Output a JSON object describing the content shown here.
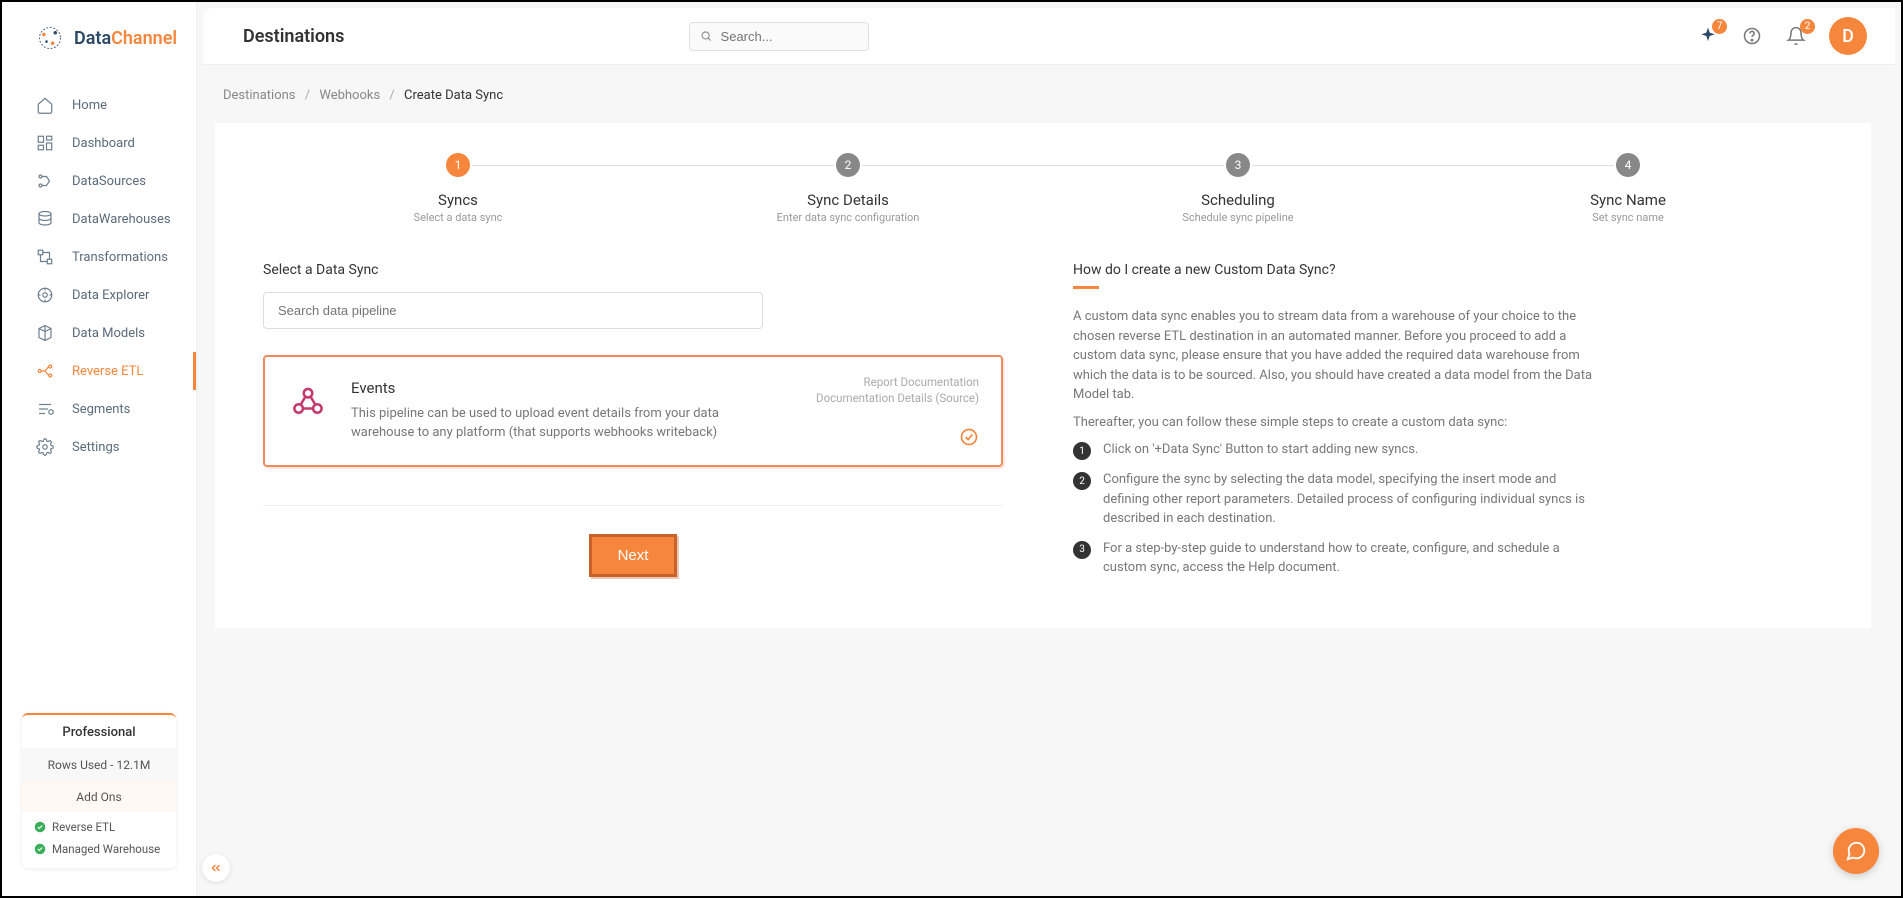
{
  "brand": {
    "part1": "Data",
    "part2": "Channel"
  },
  "sidebar": {
    "items": [
      {
        "label": "Home"
      },
      {
        "label": "Dashboard"
      },
      {
        "label": "DataSources"
      },
      {
        "label": "DataWarehouses"
      },
      {
        "label": "Transformations"
      },
      {
        "label": "Data Explorer"
      },
      {
        "label": "Data Models"
      },
      {
        "label": "Reverse ETL"
      },
      {
        "label": "Segments"
      },
      {
        "label": "Settings"
      }
    ],
    "plan": {
      "title": "Professional",
      "rows": "Rows Used - 12.1M",
      "addons": "Add Ons",
      "features": [
        "Reverse ETL",
        "Managed Warehouse"
      ]
    }
  },
  "header": {
    "title": "Destinations",
    "search_placeholder": "Search...",
    "spark_badge": "7",
    "bell_badge": "2",
    "avatar": "D"
  },
  "breadcrumb": {
    "a": "Destinations",
    "b": "Webhooks",
    "c": "Create Data Sync"
  },
  "stepper": [
    {
      "num": "1",
      "title": "Syncs",
      "sub": "Select a data sync"
    },
    {
      "num": "2",
      "title": "Sync Details",
      "sub": "Enter data sync configuration"
    },
    {
      "num": "3",
      "title": "Scheduling",
      "sub": "Schedule sync pipeline"
    },
    {
      "num": "4",
      "title": "Sync Name",
      "sub": "Set sync name"
    }
  ],
  "select": {
    "label": "Select a Data Sync",
    "search_placeholder": "Search data pipeline"
  },
  "card": {
    "title": "Events",
    "desc": "This pipeline can be used to upload event details from your data warehouse to any platform (that supports webhooks writeback)",
    "link1": "Report Documentation",
    "link2": "Documentation Details (Source)"
  },
  "next_label": "Next",
  "help": {
    "title": "How do I create a new Custom Data Sync?",
    "p1": "A custom data sync enables you to stream data from a warehouse of your choice to the chosen reverse ETL destination in an automated manner. Before you proceed to add a custom data sync, please ensure that you have added the required data warehouse from which the data is to be sourced. Also, you should have created a data model from the Data Model tab.",
    "p2": "Thereafter, you can follow these simple steps to create a custom data sync:",
    "steps": [
      "Click on '+Data Sync' Button to start adding new syncs.",
      "Configure the sync by selecting the data model, specifying the insert mode and defining other report parameters. Detailed process of configuring individual syncs is described in each destination.",
      "For a step-by-step guide to understand how to create, configure, and schedule a custom sync, access the Help document."
    ]
  }
}
